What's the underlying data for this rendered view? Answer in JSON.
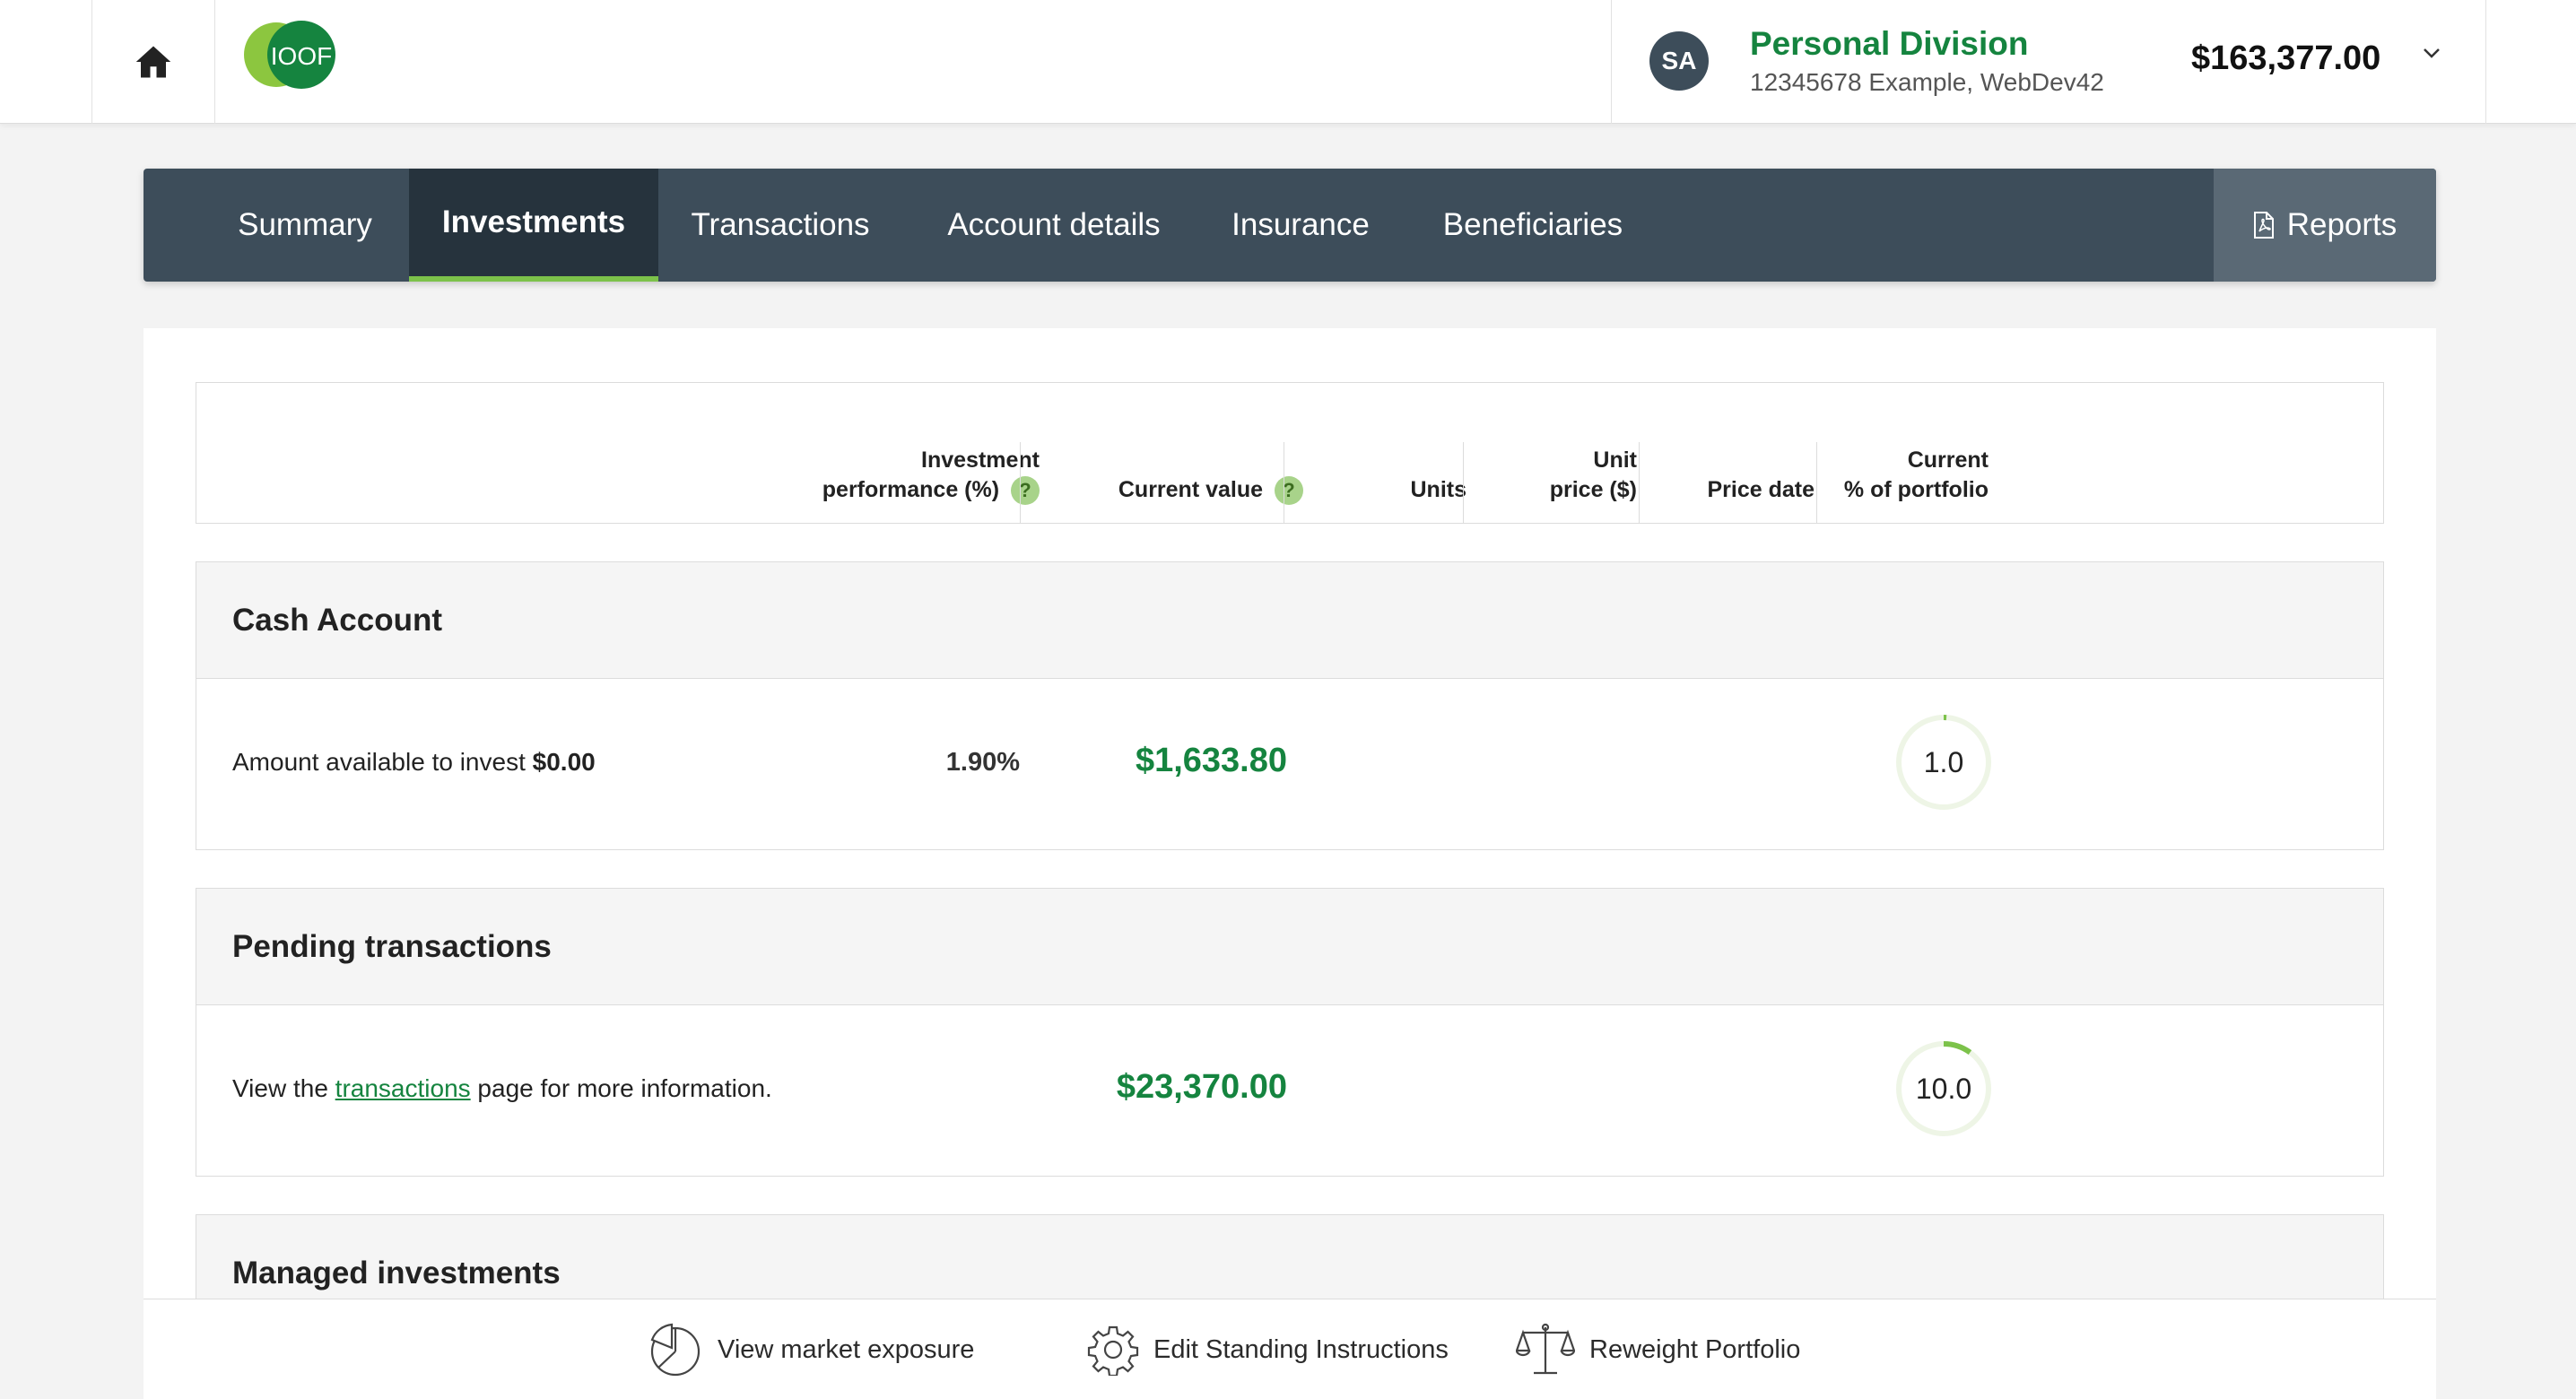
{
  "header": {
    "logo_text": "IOOF",
    "account": {
      "avatar_initials": "SA",
      "name": "Personal Division",
      "subtitle": "12345678 Example, WebDev42",
      "balance": "$163,377.00"
    }
  },
  "nav": {
    "tabs": [
      {
        "label": "Summary",
        "active": false
      },
      {
        "label": "Investments",
        "active": true
      },
      {
        "label": "Transactions",
        "active": false
      },
      {
        "label": "Account details",
        "active": false
      },
      {
        "label": "Insurance",
        "active": false
      },
      {
        "label": "Beneficiaries",
        "active": false
      }
    ],
    "reports_label": "Reports"
  },
  "table": {
    "columns": {
      "performance_line1": "Investment",
      "performance_line2": "performance (%)",
      "current_value": "Current value",
      "units": "Units",
      "unit_price_line1": "Unit",
      "unit_price_line2": "price ($)",
      "price_date": "Price date",
      "portfolio_line1": "Current",
      "portfolio_line2": "% of portfolio"
    },
    "help_glyph": "?"
  },
  "sections": {
    "cash": {
      "title": "Cash Account",
      "text_prefix": "Amount available to invest",
      "available_amount": "$0.00",
      "performance": "1.90%",
      "current_value": "$1,633.80",
      "portfolio_percent": "1.0",
      "portfolio_fraction": 0.01
    },
    "pending": {
      "title": "Pending transactions",
      "text_before": "View the",
      "link_text": "transactions",
      "text_after": "page for more information.",
      "current_value": "$23,370.00",
      "portfolio_percent": "10.0",
      "portfolio_fraction": 0.1
    },
    "managed": {
      "title": "Managed investments"
    }
  },
  "footer": {
    "market_exposure": "View market exposure",
    "standing_instructions": "Edit Standing Instructions",
    "reweight": "Reweight Portfolio"
  },
  "colors": {
    "brand_green": "#15843f",
    "nav_bg": "#3d4d5a",
    "nav_active_bg": "#26333d",
    "accent_light_green": "#7cc24a"
  }
}
